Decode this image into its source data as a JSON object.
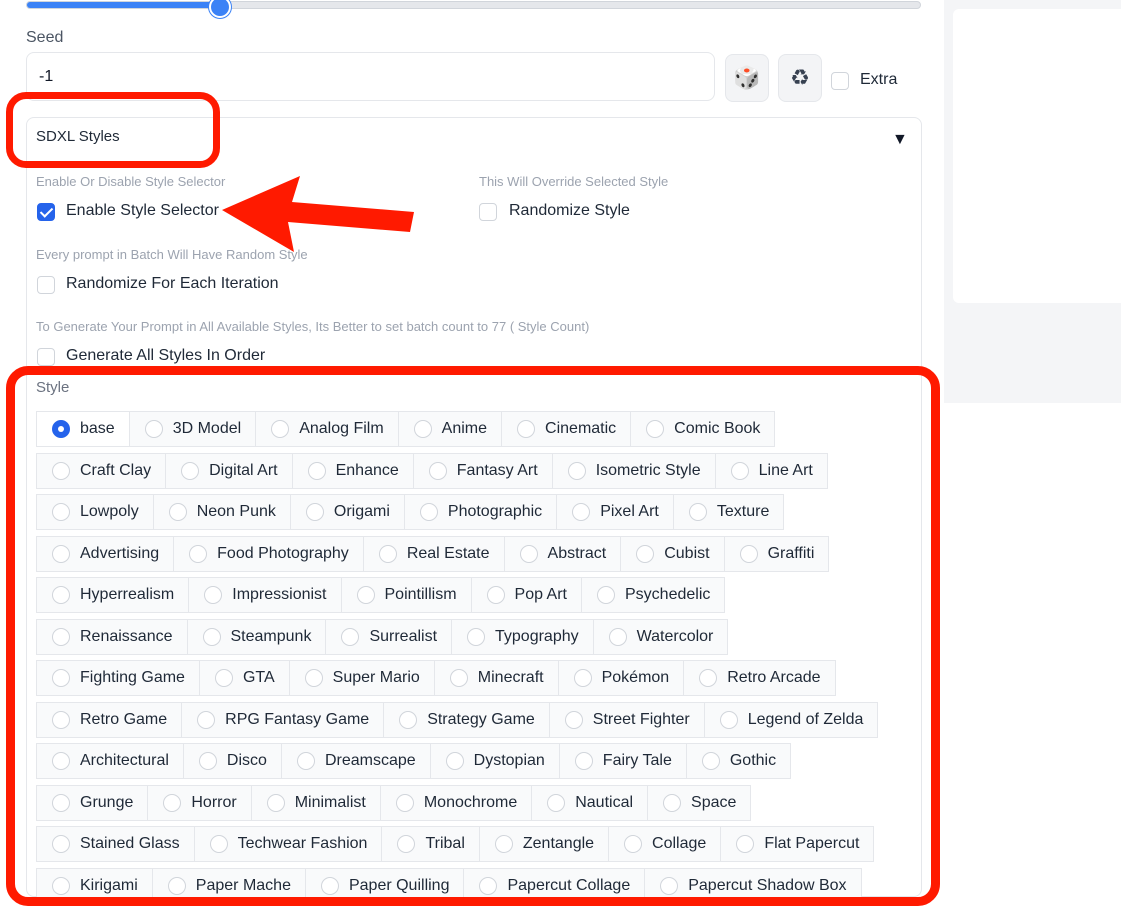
{
  "slider": {
    "value_fraction": 0.214
  },
  "seed": {
    "label": "Seed",
    "value": "-1",
    "extra_label": "Extra",
    "dice_icon": "🎲",
    "recycle_icon": "♻"
  },
  "accordion": {
    "title": "SDXL Styles",
    "hint_enable": "Enable Or Disable Style Selector",
    "enable_label": "Enable Style Selector",
    "hint_override": "This Will Override Selected Style",
    "randomize_style_label": "Randomize Style",
    "hint_batch": "Every prompt in Batch Will Have Random Style",
    "randomize_iter_label": "Randomize For Each Iteration",
    "hint_generate": "To Generate Your Prompt in All Available Styles, Its Better to set batch count to 77 ( Style Count)",
    "generate_all_label": "Generate All Styles In Order"
  },
  "style": {
    "label": "Style",
    "selected": "base",
    "rows": [
      [
        "base",
        "3D Model",
        "Analog Film",
        "Anime",
        "Cinematic",
        "Comic Book"
      ],
      [
        "Craft Clay",
        "Digital Art",
        "Enhance",
        "Fantasy Art",
        "Isometric Style",
        "Line Art"
      ],
      [
        "Lowpoly",
        "Neon Punk",
        "Origami",
        "Photographic",
        "Pixel Art",
        "Texture"
      ],
      [
        "Advertising",
        "Food Photography",
        "Real Estate",
        "Abstract",
        "Cubist",
        "Graffiti"
      ],
      [
        "Hyperrealism",
        "Impressionist",
        "Pointillism",
        "Pop Art",
        "Psychedelic"
      ],
      [
        "Renaissance",
        "Steampunk",
        "Surrealist",
        "Typography",
        "Watercolor"
      ],
      [
        "Fighting Game",
        "GTA",
        "Super Mario",
        "Minecraft",
        "Pokémon",
        "Retro Arcade"
      ],
      [
        "Retro Game",
        "RPG Fantasy Game",
        "Strategy Game",
        "Street Fighter",
        "Legend of Zelda"
      ],
      [
        "Architectural",
        "Disco",
        "Dreamscape",
        "Dystopian",
        "Fairy Tale",
        "Gothic"
      ],
      [
        "Grunge",
        "Horror",
        "Minimalist",
        "Monochrome",
        "Nautical",
        "Space"
      ],
      [
        "Stained Glass",
        "Techwear Fashion",
        "Tribal",
        "Zentangle",
        "Collage",
        "Flat Papercut"
      ],
      [
        "Kirigami",
        "Paper Mache",
        "Paper Quilling",
        "Papercut Collage",
        "Papercut Shadow Box"
      ]
    ]
  },
  "colors": {
    "accent": "#2563eb",
    "highlight": "#ff1a00"
  }
}
